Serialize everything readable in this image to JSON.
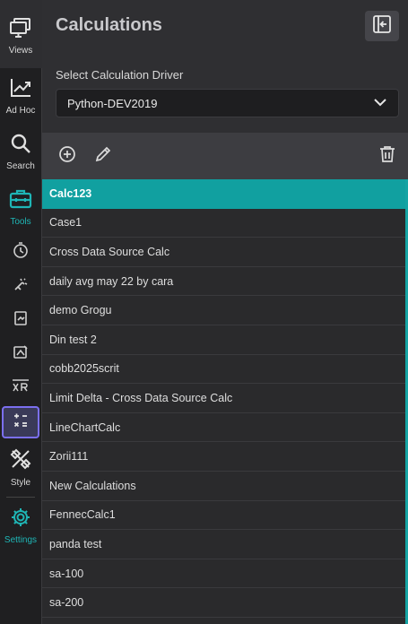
{
  "rail": {
    "views": "Views",
    "adhoc": "Ad Hoc",
    "search": "Search",
    "tools": "Tools",
    "style": "Style",
    "settings": "Settings",
    "accent_color": "#1fb6b6",
    "active_color": "#7b6ff0"
  },
  "panel": {
    "title": "Calculations",
    "driver_label": "Select Calculation Driver",
    "driver_value": "Python-DEV2019"
  },
  "calculations": [
    "Calc123",
    "Case1",
    "Cross Data Source Calc",
    "daily avg may 22 by cara",
    "demo Grogu",
    "Din test 2",
    "cobb2025scrit",
    "Limit Delta - Cross Data Source Calc",
    "LineChartCalc",
    "Zorii111",
    "New Calculations",
    "FennecCalc1",
    "panda test",
    "sa-100",
    "sa-200"
  ],
  "selected_index": 0
}
